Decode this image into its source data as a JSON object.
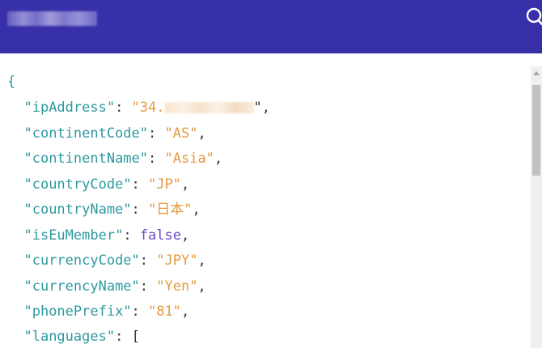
{
  "header": {
    "title_blurred": true,
    "search_icon": "search-icon",
    "background_color": "#3730a9"
  },
  "json_view": {
    "open_brace": "{",
    "lines": [
      {
        "key": "\"ipAddress\"",
        "sep": ": ",
        "value": "\"34.",
        "redacted": true,
        "tail": "\",",
        "type": "string"
      },
      {
        "key": "\"continentCode\"",
        "sep": ": ",
        "value": "\"AS\"",
        "tail": ",",
        "type": "string"
      },
      {
        "key": "\"continentName\"",
        "sep": ": ",
        "value": "\"Asia\"",
        "tail": ",",
        "type": "string"
      },
      {
        "key": "\"countryCode\"",
        "sep": ": ",
        "value": "\"JP\"",
        "tail": ",",
        "type": "string"
      },
      {
        "key": "\"countryName\"",
        "sep": ": ",
        "value": "\"日本\"",
        "tail": ",",
        "type": "string"
      },
      {
        "key": "\"isEuMember\"",
        "sep": ": ",
        "value": "false",
        "tail": ",",
        "type": "boolean"
      },
      {
        "key": "\"currencyCode\"",
        "sep": ": ",
        "value": "\"JPY\"",
        "tail": ",",
        "type": "string"
      },
      {
        "key": "\"currencyName\"",
        "sep": ": ",
        "value": "\"Yen\"",
        "tail": ",",
        "type": "string"
      },
      {
        "key": "\"phonePrefix\"",
        "sep": ": ",
        "value": "\"81\"",
        "tail": ",",
        "type": "string"
      },
      {
        "key": "\"languages\"",
        "sep": ": ",
        "value": "[",
        "tail": "",
        "type": "bracket"
      }
    ]
  },
  "colors": {
    "key": "#2e9aa0",
    "string": "#e39a3f",
    "keyword": "#6c49c8",
    "punctuation": "#37373c"
  }
}
